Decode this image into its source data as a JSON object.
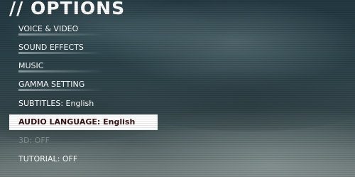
{
  "screen": {
    "title": "// OPTIONS",
    "colors": {
      "text": "#ffffff",
      "selected_background": "#ffffff",
      "selected_text": "#3a1414",
      "disabled_text": "#9aa6a6"
    }
  },
  "menu": {
    "items": [
      {
        "label": "VOICE & VIDEO",
        "state": "normal"
      },
      {
        "label": "SOUND EFFECTS",
        "state": "normal"
      },
      {
        "label": "MUSIC",
        "state": "normal"
      },
      {
        "label": "GAMMA SETTING",
        "state": "normal"
      },
      {
        "label": "SUBTITLES: English",
        "state": "normal"
      },
      {
        "label": "AUDIO LANGUAGE: English",
        "state": "selected"
      },
      {
        "label": "3D: OFF",
        "state": "disabled"
      },
      {
        "label": "TUTORIAL: OFF",
        "state": "normal"
      }
    ]
  }
}
